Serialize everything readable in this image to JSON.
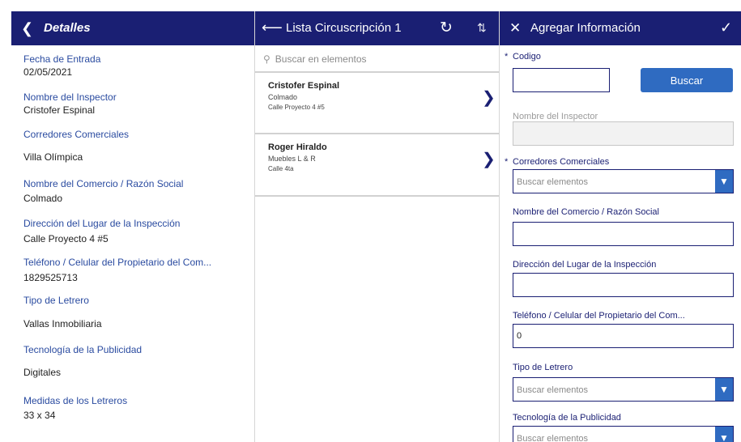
{
  "left": {
    "header_title": "Detalles",
    "fields": [
      {
        "label": "Fecha de Entrada",
        "value": "02/05/2021"
      },
      {
        "label": "Nombre del Inspector",
        "value": "Cristofer Espinal"
      },
      {
        "label": "Corredores Comerciales",
        "value": "Villa Olímpica"
      },
      {
        "label": "Nombre del Comercio / Razón Social",
        "value": "Colmado"
      },
      {
        "label": "Dirección del Lugar de la Inspección",
        "value": "Calle Proyecto 4 #5"
      },
      {
        "label": "Teléfono / Celular del Propietario del Com...",
        "value": "1829525713"
      },
      {
        "label": "Tipo de Letrero",
        "value": "Vallas Inmobiliaria"
      },
      {
        "label": "Tecnología de la Publicidad",
        "value": "Digitales"
      },
      {
        "label": "Medidas de los Letreros",
        "value": "33 x 34"
      }
    ]
  },
  "mid": {
    "header_title": "Lista Circuscripción 1",
    "search_placeholder": "Buscar en elementos",
    "items": [
      {
        "name": "Cristofer Espinal",
        "line2": "Colmado",
        "line3": "Calle Proyecto 4 #5"
      },
      {
        "name": "Roger Hiraldo",
        "line2": "Muebles L & R",
        "line3": "Calle 4ta"
      }
    ]
  },
  "right": {
    "header_title": "Agregar Información",
    "codigo_label": "Codigo",
    "buscar_button": "Buscar",
    "inspector_label": "Nombre del Inspector",
    "corredores_label": "Corredores Comerciales",
    "corredores_placeholder": "Buscar elementos",
    "comercio_label": "Nombre del Comercio / Razón Social",
    "direccion_label": "Dirección del Lugar de la Inspección",
    "telefono_label": "Teléfono / Celular del Propietario del Com...",
    "telefono_value": "0",
    "tipo_label": "Tipo de Letrero",
    "tipo_placeholder": "Buscar elementos",
    "tecnologia_label": "Tecnología de la Publicidad",
    "tecnologia_placeholder": "Buscar elementos"
  },
  "colors": {
    "header_bg": "#1a1f73",
    "label_blue": "#2a4ba0",
    "button_blue": "#2f6bc1"
  },
  "icons": [
    "chevron-left-icon",
    "arrow-left-icon",
    "reload-icon",
    "sort-icon",
    "search-icon",
    "chevron-right-icon",
    "close-icon",
    "checkmark-icon",
    "dropdown-arrow-icon"
  ]
}
